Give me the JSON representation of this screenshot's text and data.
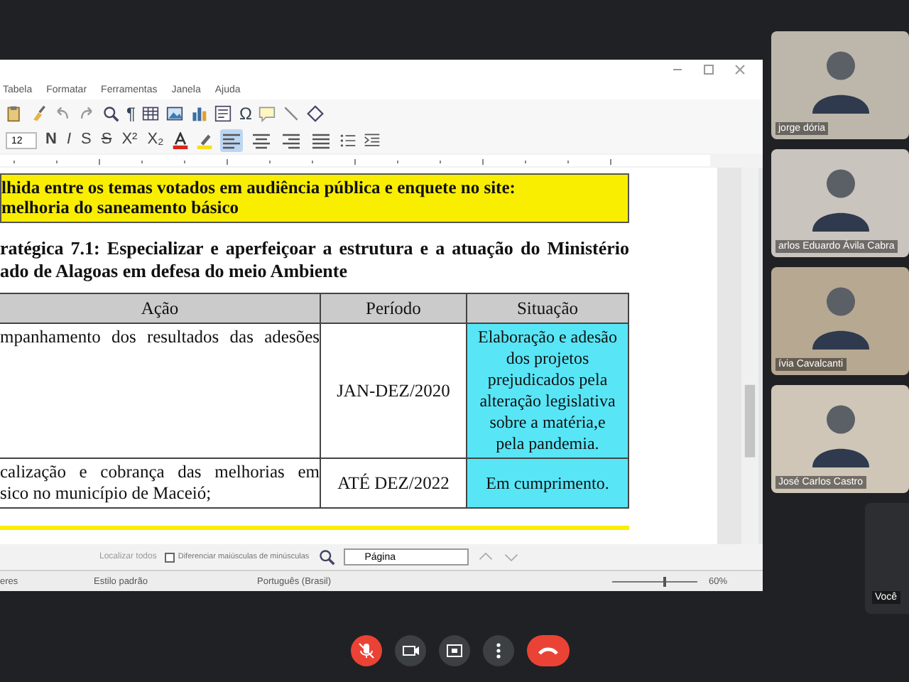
{
  "editor": {
    "menu": [
      "Tabela",
      "Formatar",
      "Ferramentas",
      "Janela",
      "Ajuda"
    ],
    "toolbar_1": [
      {
        "kind": "paste"
      },
      {
        "kind": "brush"
      },
      {
        "kind": "undo"
      },
      {
        "kind": "redo"
      },
      {
        "kind": "find"
      },
      {
        "kind": "glyph",
        "label": "¶"
      },
      {
        "kind": "table"
      },
      {
        "kind": "image"
      },
      {
        "kind": "chart"
      },
      {
        "kind": "textbox"
      },
      {
        "kind": "glyph",
        "label": "Ω"
      },
      {
        "kind": "comment"
      },
      {
        "kind": "line"
      },
      {
        "kind": "shape"
      }
    ],
    "font_size": "12",
    "format_buttons": [
      "N",
      "I",
      "S",
      "S",
      "X²",
      "X₂"
    ],
    "align_buttons": [
      {
        "selected": true
      },
      {
        "selected": false
      },
      {
        "selected": false
      },
      {
        "selected": false
      }
    ],
    "document": {
      "highlight_lines": [
        "lhida entre os temas votados em audiência pública e enquete no site:",
        "melhoria do saneamento básico"
      ],
      "heading_lines": [
        "ratégica 7.1: Especializar e aperfeiçoar a estrutura e a atuação do Ministério",
        "ado de Alagoas em defesa do meio Ambiente"
      ],
      "table": {
        "columns": [
          "Ação",
          "Período",
          "Situação"
        ],
        "rows": [
          {
            "action": [
              "mpanhamento dos resultados das adesões"
            ],
            "period": "JAN-DEZ/2020",
            "status": [
              "Elaboração e adesão",
              "dos projetos",
              "prejudicados pela",
              "alteração legislativa",
              "sobre a matéria,e",
              "pela pandemia."
            ]
          },
          {
            "action": [
              "calização e cobrança das melhorias em",
              "sico no município de Maceió;"
            ],
            "period": "ATÉ DEZ/2022",
            "status": [
              "Em cumprimento."
            ]
          }
        ]
      }
    },
    "find_bar": {
      "find_all": "Localizar todos",
      "match_case": {
        "label": "Diferenciar maiúsculas de minúsculas",
        "checked": false
      },
      "search_type": "Página"
    },
    "status_bar": {
      "word_count": "eres",
      "style": "Estilo padrão",
      "language": "Português (Brasil)",
      "zoom_slider": {
        "level": 0.6
      },
      "zoom": "60%"
    }
  },
  "participants": [
    {
      "name": "jorge dória"
    },
    {
      "name": "arlos Eduardo Ávila Cabra"
    },
    {
      "name": "ívia Cavalcanti"
    },
    {
      "name": "José Carlos Castro"
    }
  ],
  "self_tile": {
    "name": "Você"
  },
  "controls": [
    {
      "kind": "mic",
      "muted": true
    },
    {
      "kind": "camera"
    },
    {
      "kind": "present"
    },
    {
      "kind": "more"
    },
    {
      "kind": "hangup"
    }
  ]
}
